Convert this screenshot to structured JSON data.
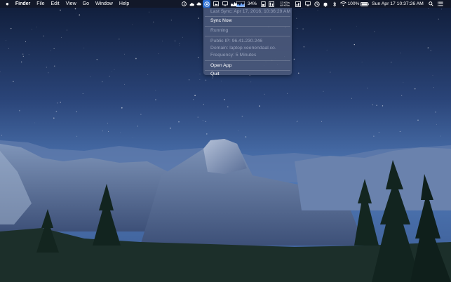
{
  "menubar": {
    "apple_icon": "apple-logo-icon",
    "items": [
      "Finder",
      "File",
      "Edit",
      "View",
      "Go",
      "Window",
      "Help"
    ],
    "battery_percent": "34%",
    "net_up": "12 KB/s",
    "net_down": "48 KB/s",
    "battery_status": "100%",
    "clock": "Sun Apr 17  10:37:26 AM"
  },
  "dropdown": {
    "last_sync": "Last Sync: Apr 17, 2016, 10:36:29 AM",
    "sync_now": "Sync Now",
    "status": "Running",
    "public_ip": "Public IP: 96.41.230.246",
    "domain": "Domain: laptop.veenendaal.co.",
    "frequency": "Frequency: 5 Minutes",
    "open_app": "Open App",
    "quit": "Quit"
  },
  "colors": {
    "sky_top": "#12203e",
    "sky_bottom": "#4f74b3",
    "menu_bg": "#4a587a",
    "highlight": "#2a6fd6"
  }
}
